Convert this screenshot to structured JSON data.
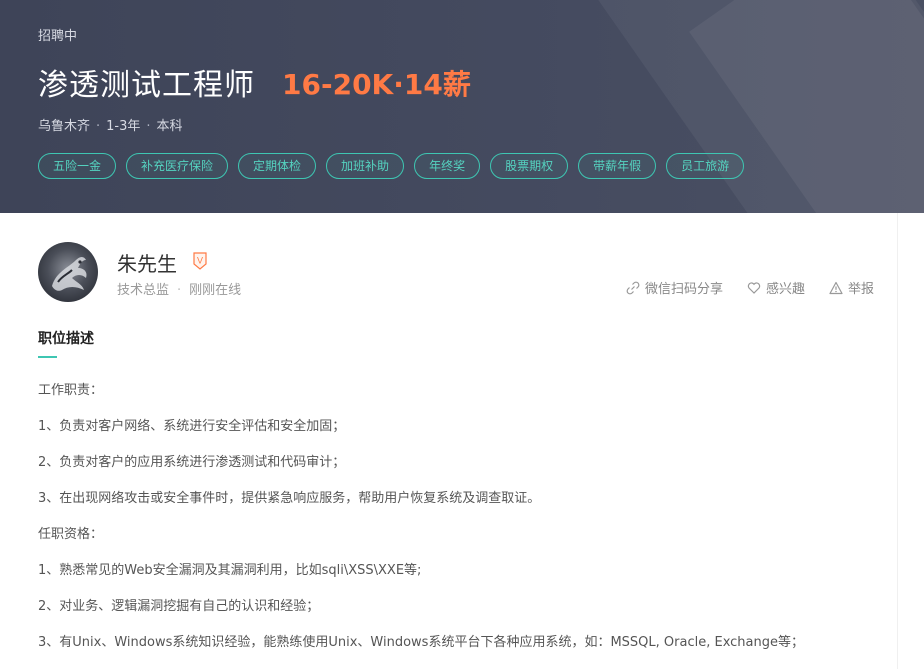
{
  "header": {
    "status": "招聘中",
    "title": "渗透测试工程师",
    "salary": "16-20K·14薪",
    "location": "乌鲁木齐",
    "experience": "1-3年",
    "education": "本科",
    "separator": "·",
    "benefits": [
      "五险一金",
      "补充医疗保险",
      "定期体检",
      "加班补助",
      "年终奖",
      "股票期权",
      "带薪年假",
      "员工旅游"
    ]
  },
  "recruiter": {
    "name": "朱先生",
    "badge": "V",
    "position": "技术总监",
    "separator": "·",
    "online_status": "刚刚在线"
  },
  "actions": {
    "share": "微信扫码分享",
    "interest": "感兴趣",
    "report": "举报"
  },
  "description": {
    "title": "职位描述",
    "lines": [
      "工作职责：",
      "1、负责对客户网络、系统进行安全评估和安全加固；",
      "2、负责对客户的应用系统进行渗透测试和代码审计；",
      "3、在出现网络攻击或安全事件时，提供紧急响应服务，帮助用户恢复系统及调查取证。",
      "任职资格：",
      "1、熟悉常见的Web安全漏洞及其漏洞利用，比如sqli\\XSS\\XXE等;",
      "2、对业务、逻辑漏洞挖掘有自己的认识和经验；",
      "3、有Unix、Windows系统知识经验，能熟练使用Unix、Windows系统平台下各种应用系统，如：MSSQL, Oracle, Exchange等；"
    ]
  },
  "colors": {
    "banner_bg": "#444a5f",
    "salary": "#ff7a45",
    "tag_accent": "#3ec6b2",
    "badge": "#ff7a45"
  },
  "icons": {
    "share": "link-icon",
    "interest": "heart-icon",
    "report": "warning-icon",
    "avatar": "dragon-avatar"
  }
}
